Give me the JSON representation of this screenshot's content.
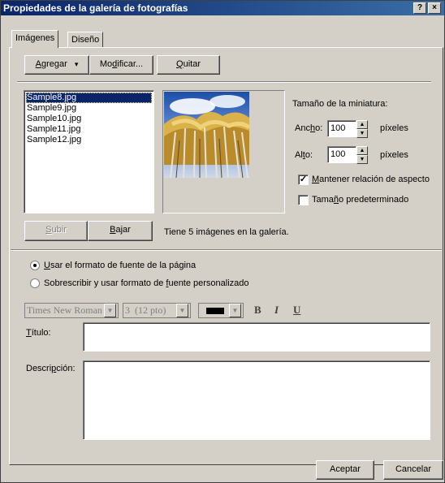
{
  "window": {
    "title": "Propiedades de la galería de fotografías",
    "help_label": "?",
    "close_label": "×"
  },
  "tabs": [
    {
      "label": "Imágenes",
      "active": true
    },
    {
      "label": "Diseño",
      "active": false
    }
  ],
  "toolbar": {
    "add_label_pre": "",
    "add_label_u": "A",
    "add_label_post": "gregar",
    "add_arrow": "▾",
    "modify_pre": "Mo",
    "modify_u": "d",
    "modify_post": "ificar...",
    "remove_u": "Q",
    "remove_post": "uitar"
  },
  "images": {
    "list": [
      "Sample8.jpg",
      "Sample9.jpg",
      "Sample10.jpg",
      "Sample11.jpg",
      "Sample12.jpg"
    ],
    "selected_index": 0,
    "count_text": "Tiene 5 imágenes en la galería."
  },
  "thumbnail": {
    "title": "Tamaño de la miniatura:",
    "width_label_pre": "Anc",
    "width_label_u": "h",
    "width_label_post": "o:",
    "width_value": "100",
    "width_unit": "píxeles",
    "height_label_pre": "Al",
    "height_label_u": "t",
    "height_label_post": "o:",
    "height_value": "100",
    "height_unit": "píxeles",
    "keep_aspect_u": "M",
    "keep_aspect_post": "antener relación de aspecto",
    "keep_aspect_checked": true,
    "default_size_pre": "Tama",
    "default_size_u": "ñ",
    "default_size_post": "o predeterminado",
    "default_size_checked": false
  },
  "move": {
    "up_u": "S",
    "up_post": "ubir",
    "down_u": "B",
    "down_post": "ajar"
  },
  "format": {
    "opt1_u": "U",
    "opt1_post": "sar el formato de fuente de la página",
    "opt1_selected": true,
    "opt2_pre": "Sobrescribir y usar formato de ",
    "opt2_u": "f",
    "opt2_post": "uente personalizado",
    "opt2_selected": false,
    "font_name": "Times New Roman",
    "font_size": "3  (12 pto)",
    "bold_label": "B",
    "italic_label": "I",
    "underline_label": "U",
    "color": "#000000"
  },
  "fields": {
    "title_u": "T",
    "title_post": "ítulo:",
    "title_value": "",
    "desc_pre": "Descri",
    "desc_u": "p",
    "desc_post": "ción:",
    "desc_value": ""
  },
  "footer": {
    "ok_label": "Aceptar",
    "cancel_label": "Cancelar"
  }
}
